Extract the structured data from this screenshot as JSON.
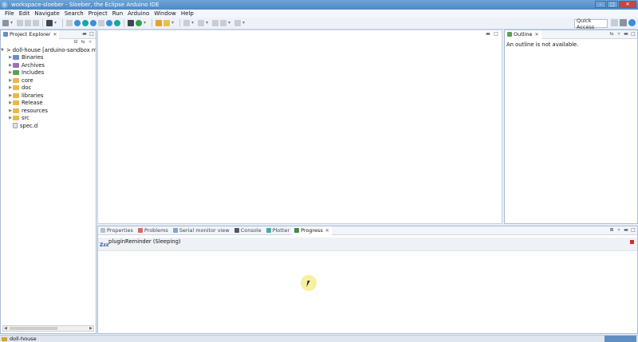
{
  "window": {
    "title": "workspace-sloeber - Sloeber, the Eclipse Arduino IDE",
    "min_label": "–",
    "max_label": "□",
    "close_label": "✕"
  },
  "menu": [
    "File",
    "Edit",
    "Navigate",
    "Search",
    "Project",
    "Run",
    "Arduino",
    "Window",
    "Help"
  ],
  "toolbar": {
    "quick_access": "Quick Access"
  },
  "project_explorer": {
    "title": "Project Explorer",
    "root": "> doll-house [arduino-sandbox mas",
    "items": [
      {
        "label": "Binaries",
        "icon": "binaries-icon"
      },
      {
        "label": "Archives",
        "icon": "archives-icon"
      },
      {
        "label": "Includes",
        "icon": "includes-icon"
      },
      {
        "label": "core",
        "icon": "folder-icon"
      },
      {
        "label": "doc",
        "icon": "folder-icon"
      },
      {
        "label": "libraries",
        "icon": "folder-icon"
      },
      {
        "label": "Release",
        "icon": "folder-icon"
      },
      {
        "label": "resources",
        "icon": "folder-icon"
      },
      {
        "label": "src",
        "icon": "folder-icon"
      },
      {
        "label": "spec.d",
        "icon": "file-icon"
      }
    ]
  },
  "outline": {
    "title": "Outline",
    "message": "An outline is not available."
  },
  "bottom_tabs": [
    {
      "label": "Properties",
      "active": false
    },
    {
      "label": "Problems",
      "active": false
    },
    {
      "label": "Serial monitor view",
      "active": false
    },
    {
      "label": "Console",
      "active": false
    },
    {
      "label": "Plotter",
      "active": false
    },
    {
      "label": "Progress",
      "active": true
    }
  ],
  "progress": {
    "icon_text": "Zzz",
    "job": "pluginReminder (Sleeping)"
  },
  "status": {
    "selected": "doll-house"
  }
}
